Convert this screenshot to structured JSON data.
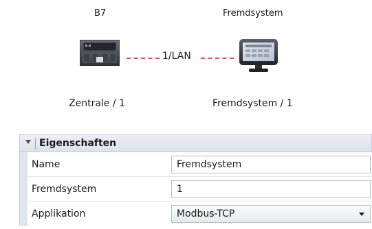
{
  "diagram": {
    "devices": [
      {
        "name": "B7",
        "subtitle": "Zentrale / 1",
        "icon": "controller-icon"
      },
      {
        "name": "Fremdsystem",
        "subtitle": "Fremdsystem / 1",
        "icon": "monitor-icon"
      }
    ],
    "link": {
      "label": "1/LAN",
      "color": "#e04848"
    }
  },
  "properties": {
    "title": "Eigenschaften",
    "rows": [
      {
        "label": "Name",
        "value": "Fremdsystem"
      },
      {
        "label": "Fremdsystem",
        "value": "1"
      },
      {
        "label": "Applikation",
        "value": "Modbus-TCP"
      }
    ]
  }
}
